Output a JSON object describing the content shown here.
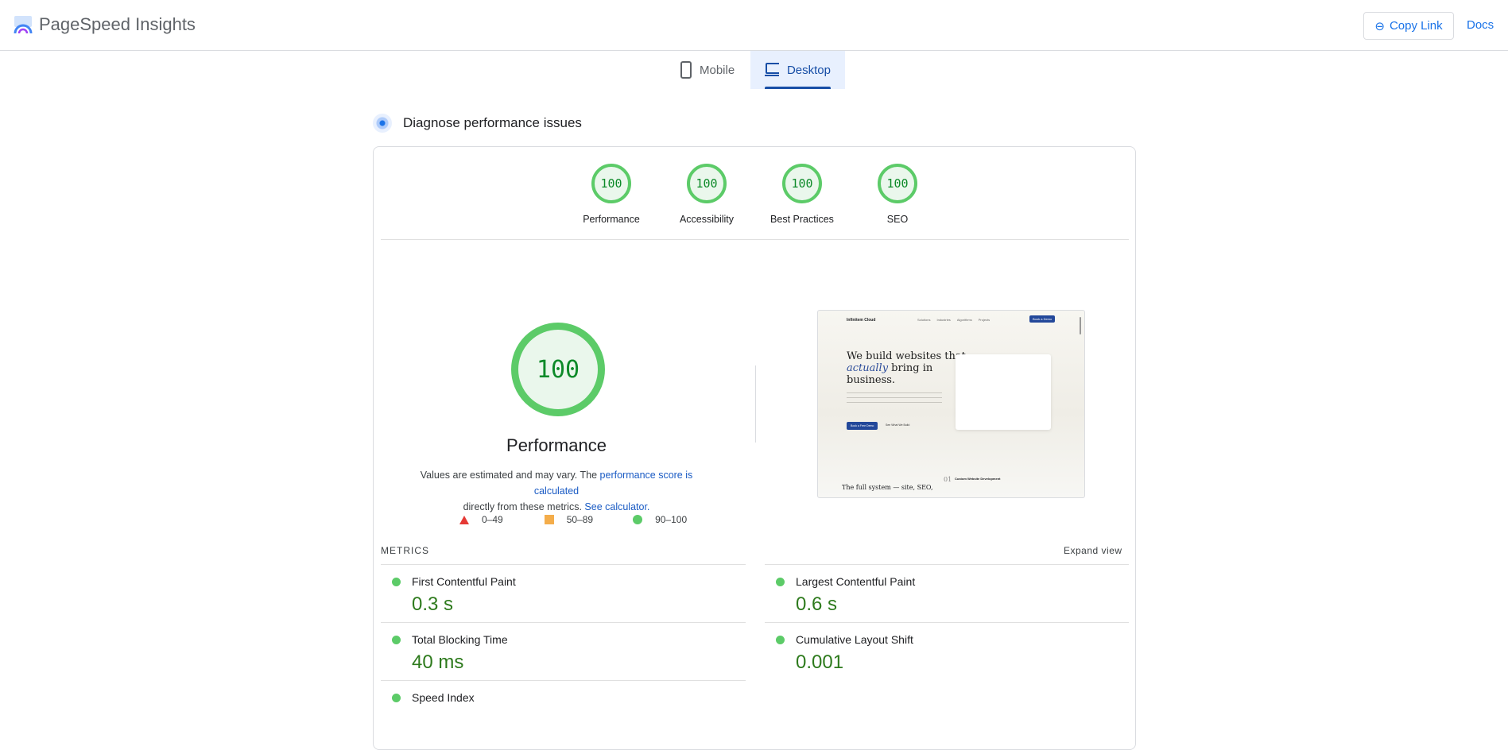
{
  "header": {
    "title": "PageSpeed Insights",
    "copy_link": "Copy Link",
    "docs": "Docs"
  },
  "tabs": [
    {
      "label": "Mobile"
    },
    {
      "label": "Desktop"
    }
  ],
  "section_title": "Diagnose performance issues",
  "categories": [
    {
      "score": "100",
      "label": "Performance"
    },
    {
      "score": "100",
      "label": "Accessibility"
    },
    {
      "score": "100",
      "label": "Best Practices"
    },
    {
      "score": "100",
      "label": "SEO"
    }
  ],
  "main_score": {
    "score": "100",
    "label": "Performance",
    "note_1": "Values are estimated and may vary. The ",
    "link_1": "performance score is calculated",
    "note_2": "directly from these metrics. ",
    "link_2": "See calculator."
  },
  "legend": [
    {
      "range": "0–49"
    },
    {
      "range": "50–89"
    },
    {
      "range": "90–100"
    }
  ],
  "thumbnail": {
    "brand": "Infinitem Cloud",
    "nav": [
      "Solutions",
      "Industries",
      "Algorithms",
      "Projects"
    ],
    "cta": "Book a Demo",
    "headline_1": "We build websites that",
    "headline_em": "actually",
    "headline_2": " bring in",
    "headline_3": "business.",
    "primary_btn": "Book a Free Demo",
    "secondary_btn": "See What We Build",
    "section": "The full system — site, SEO,",
    "number": "01",
    "service": "Custom Website Development"
  },
  "metrics_header": {
    "title": "METRICS",
    "expand": "Expand view"
  },
  "metrics": [
    {
      "label": "First Contentful Paint",
      "value": "0.3 s"
    },
    {
      "label": "Largest Contentful Paint",
      "value": "0.6 s"
    },
    {
      "label": "Total Blocking Time",
      "value": "40 ms"
    },
    {
      "label": "Cumulative Layout Shift",
      "value": "0.001"
    },
    {
      "label": "Speed Index",
      "value": ""
    }
  ],
  "colors": {
    "pass": "#5ccb68",
    "average": "#f4ad4b",
    "fail": "#e53935",
    "accent": "#1a73e8"
  }
}
